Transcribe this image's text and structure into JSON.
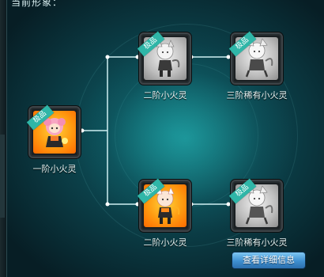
{
  "panel": {
    "title": "当前形象："
  },
  "nodes": [
    {
      "id": "root",
      "label": "一阶小火灵",
      "badge": "极品",
      "tint": "orange"
    },
    {
      "id": "upper-stage2",
      "label": "二阶小火灵",
      "badge": "极品",
      "tint": "gray"
    },
    {
      "id": "upper-stage3",
      "label": "三阶稀有小火灵",
      "badge": "极品",
      "tint": "gray"
    },
    {
      "id": "lower-stage2",
      "label": "二阶小火灵",
      "badge": "极品",
      "tint": "orange"
    },
    {
      "id": "lower-stage3",
      "label": "三阶稀有小火灵",
      "badge": "极品",
      "tint": "gray"
    }
  ],
  "buttons": {
    "detail_label": "查看详细信息"
  },
  "colors": {
    "connector": "#cfeff2",
    "ribbon": "#2fb6a8",
    "button": "#3e8fd0"
  }
}
